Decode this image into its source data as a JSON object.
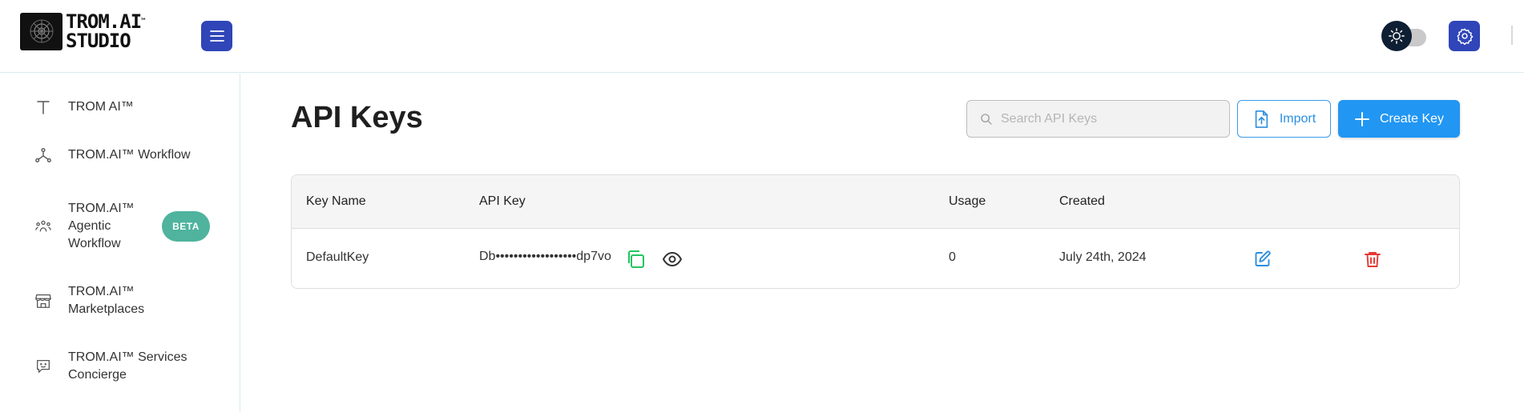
{
  "header": {
    "logo_line1": "TROM.AI",
    "logo_tm": "™",
    "logo_line2": "STUDIO"
  },
  "sidebar": {
    "items": [
      {
        "label": "TROM AI™",
        "icon": "text-icon"
      },
      {
        "label": "TROM.AI™ Workflow",
        "icon": "workflow-icon"
      },
      {
        "label_lines": [
          "TROM.AI™",
          "Agentic",
          "Workflow"
        ],
        "icon": "agents-icon",
        "badge": "BETA"
      },
      {
        "label_lines": [
          "TROM.AI™",
          "Marketplaces"
        ],
        "icon": "store-icon"
      },
      {
        "label_lines": [
          "TROM.AI™ Services",
          "Concierge"
        ],
        "icon": "chat-icon"
      }
    ]
  },
  "main": {
    "title": "API Keys",
    "search": {
      "placeholder": "Search API Keys",
      "value": ""
    },
    "import_label": "Import",
    "create_label": "Create Key",
    "table": {
      "columns": [
        "Key Name",
        "API Key",
        "Usage",
        "Created"
      ],
      "rows": [
        {
          "key_name": "DefaultKey",
          "api_key": "Db••••••••••••••••••dp7vo",
          "usage": "0",
          "created": "July 24th, 2024"
        }
      ]
    }
  },
  "colors": {
    "primary_blue": "#2196f3",
    "nav_blue": "#2f45b8",
    "beta_green": "#4fb39d",
    "copy_green": "#22c55e",
    "delete_red": "#e53935"
  }
}
